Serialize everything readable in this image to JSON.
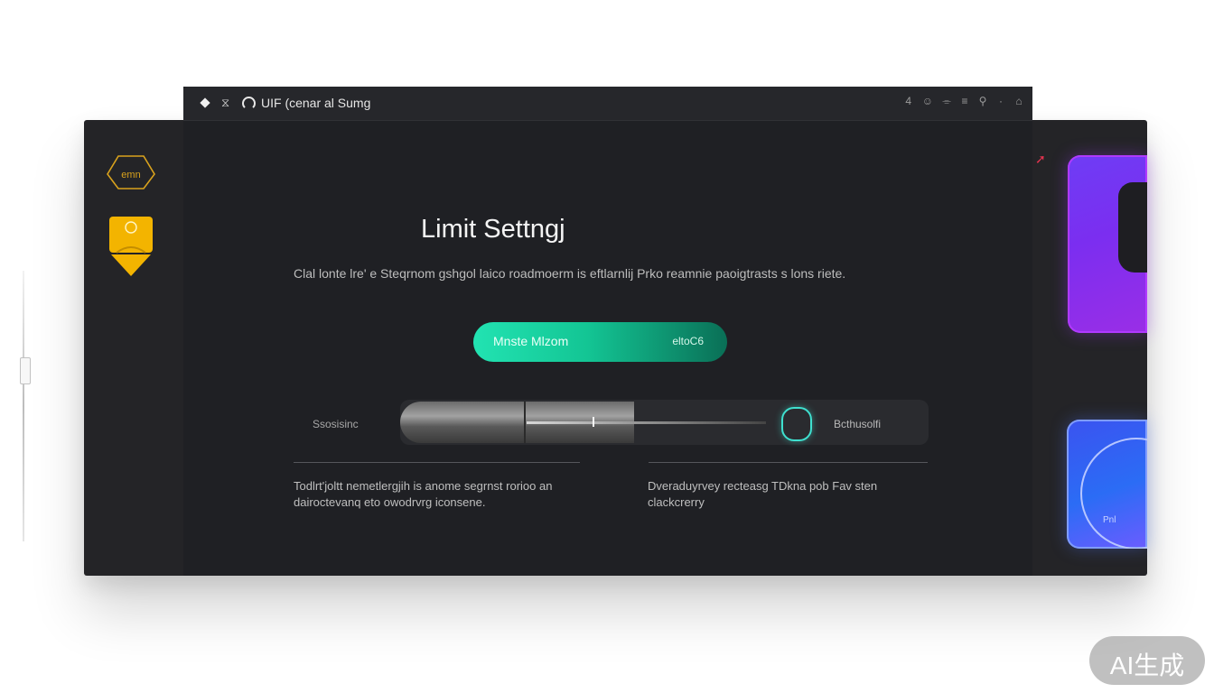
{
  "window": {
    "title": "UIF (cenar al Sumg",
    "toolbar_icons": [
      "4",
      "☺",
      "⌯",
      "≡",
      "⚲",
      "·",
      "⌂"
    ]
  },
  "sidebar": {
    "logo_text": "emn"
  },
  "main": {
    "heading": "Limit Settngj",
    "description": "Clal lonte lre' e Steqrnom gshgol laico roadmoerm is eftlarnlij Prko reamnie paoigtrasts s lons riete.",
    "cta": {
      "left_label": "Mnste Mlzom",
      "right_label": "eltoC6"
    },
    "slider": {
      "label": "Ssosisinc",
      "value_label": "Bcthusolfi",
      "level_percent": 75
    },
    "notes": [
      "Todlrt'joltt nemetlergjih is anome segrnst rorioo an dairoctevanq eto owodrvrg iconsene.",
      "Dveraduyrvey recteasg TDkna pob Fav sten clackcrerry"
    ]
  },
  "right_cards": {
    "card2_text": "Pnl"
  },
  "watermark": "AI生成",
  "colors": {
    "accent": "#1ed6a6",
    "handle": "#3fe0cf",
    "warning": "#f3b400",
    "purple_card": "#7b2ef0",
    "blue_card": "#2b6cf5"
  }
}
